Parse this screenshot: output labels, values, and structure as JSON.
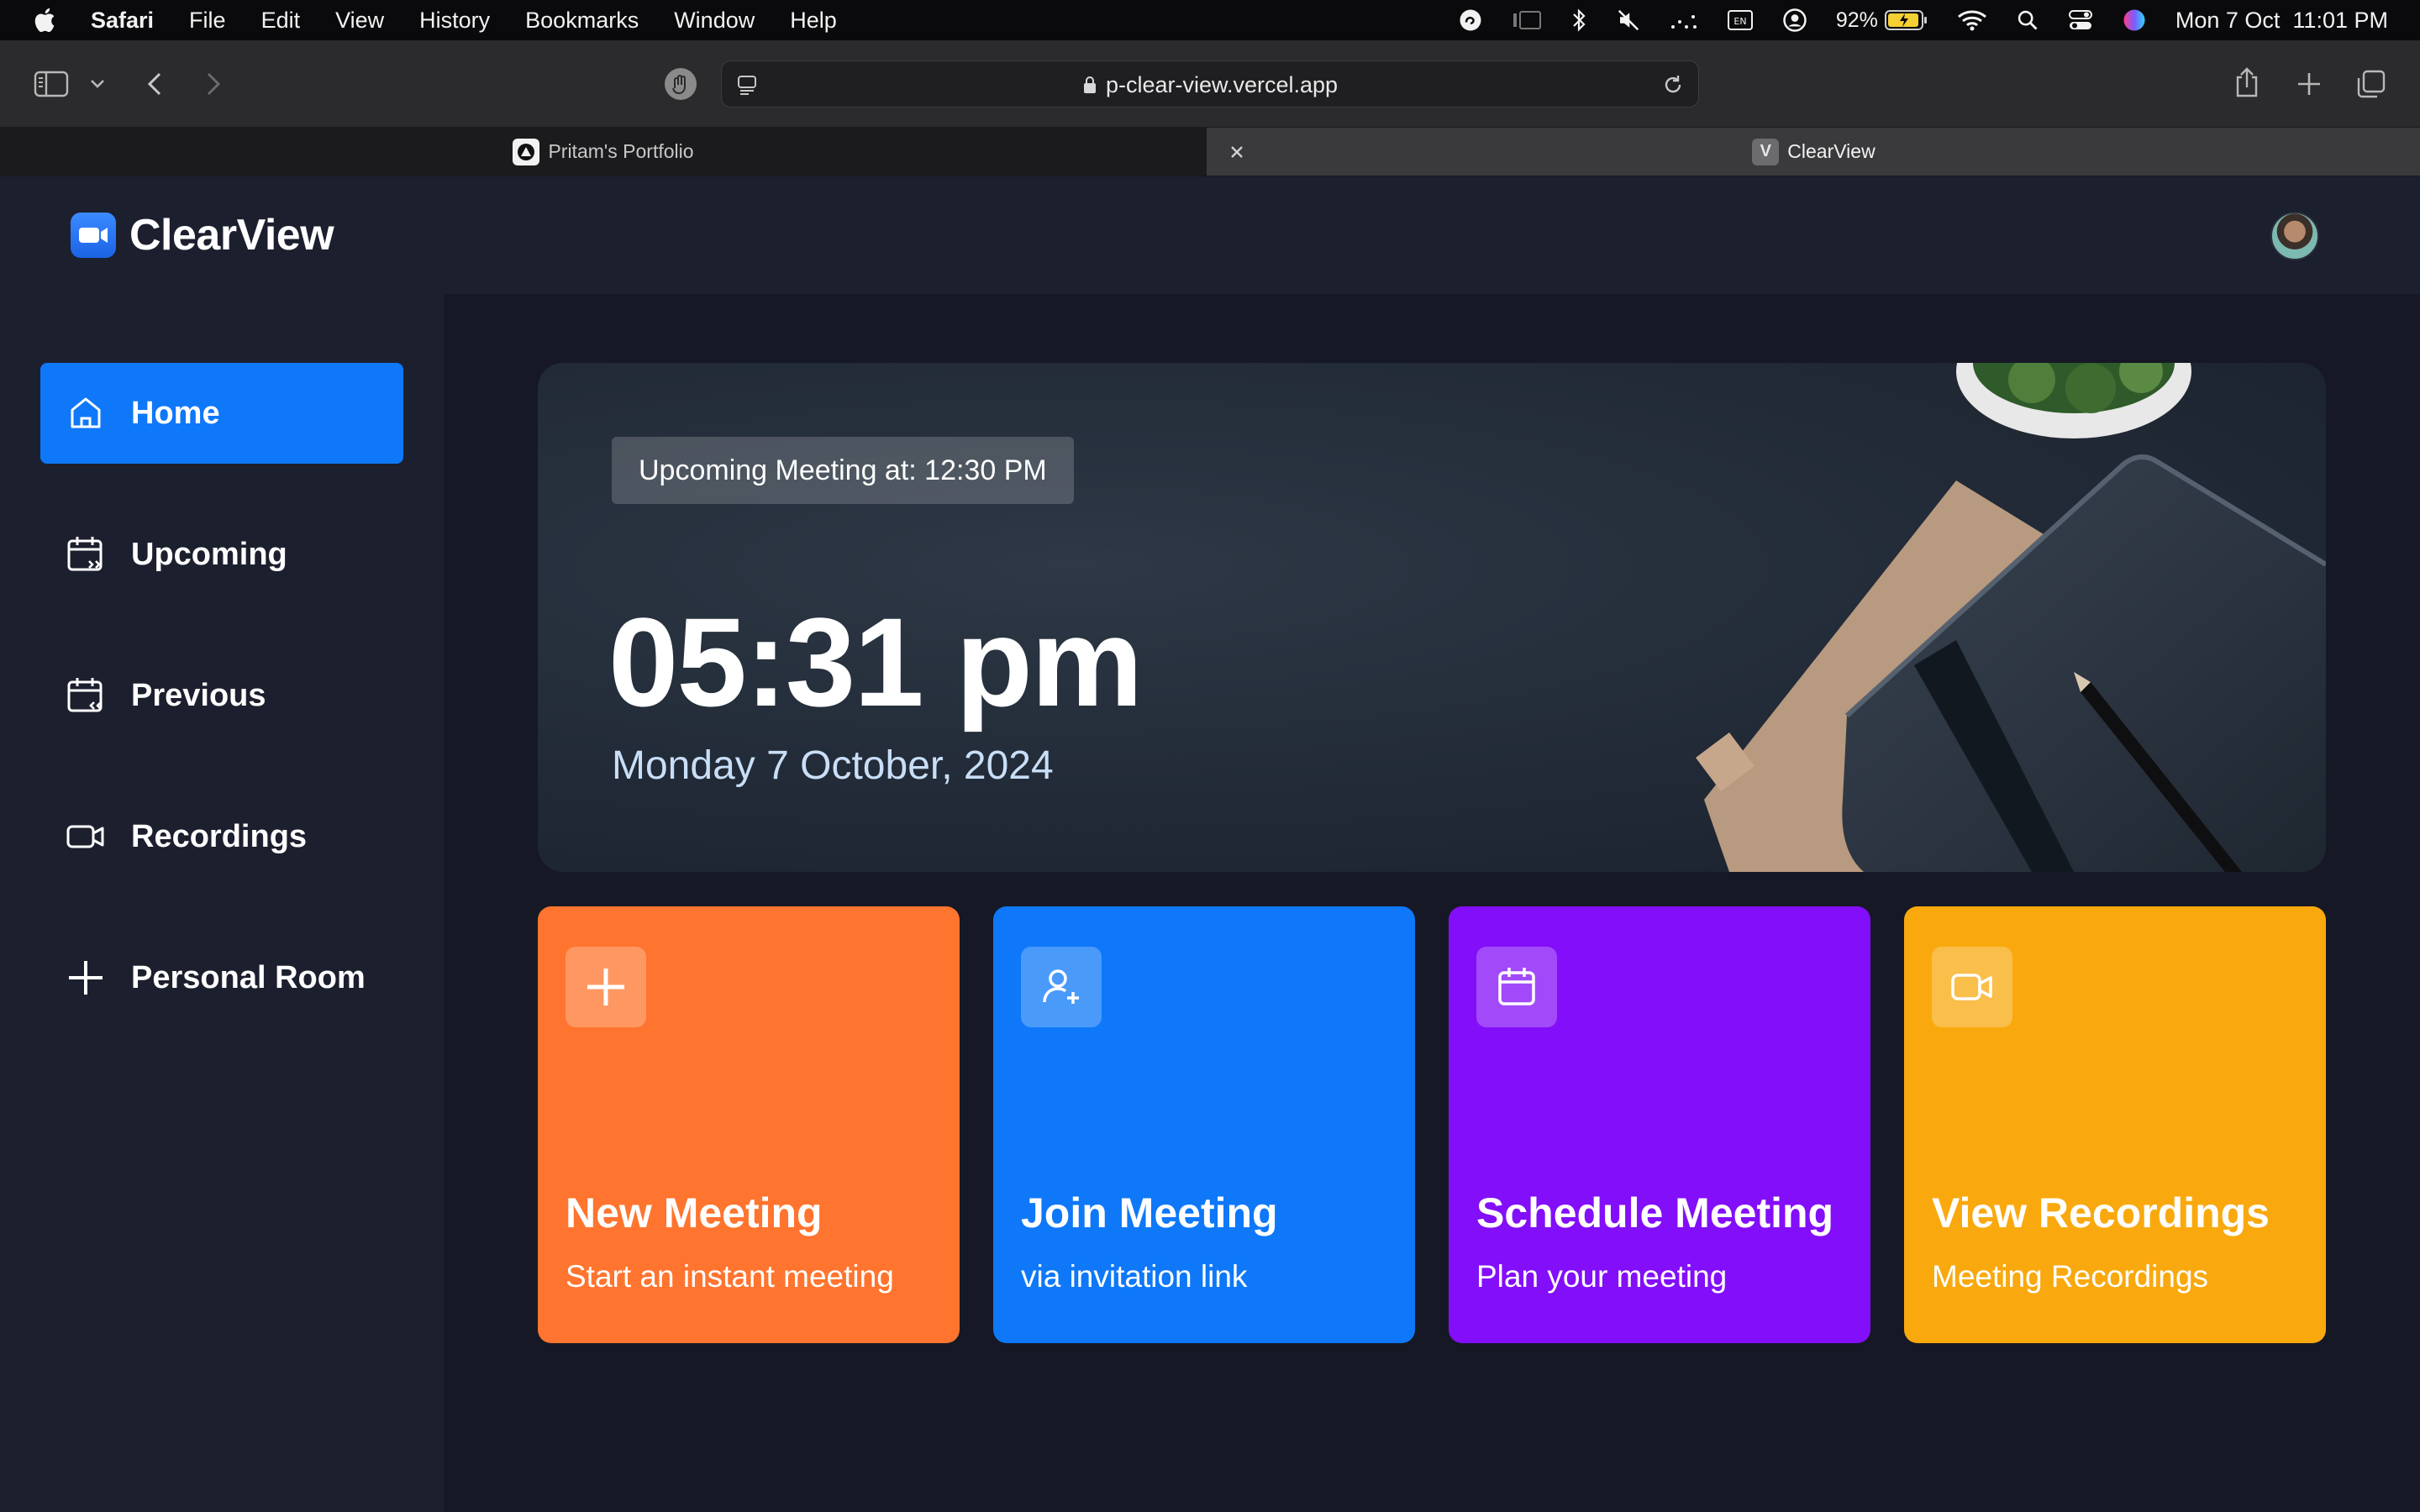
{
  "menubar": {
    "app": "Safari",
    "items": [
      "File",
      "Edit",
      "View",
      "History",
      "Bookmarks",
      "Window",
      "Help"
    ],
    "battery": "92%",
    "datetime": "Mon 7 Oct  11:01 PM"
  },
  "browser": {
    "url": "p-clear-view.vercel.app",
    "tabs": [
      {
        "title": "Pritam's Portfolio",
        "favicon": "triangle-icon"
      },
      {
        "title": "ClearView",
        "favicon": "V"
      }
    ]
  },
  "app": {
    "name": "ClearView"
  },
  "sidebar": {
    "items": [
      {
        "label": "Home",
        "icon": "home-icon",
        "active": true
      },
      {
        "label": "Upcoming",
        "icon": "calendar-forward-icon"
      },
      {
        "label": "Previous",
        "icon": "calendar-back-icon"
      },
      {
        "label": "Recordings",
        "icon": "video-icon"
      },
      {
        "label": "Personal Room",
        "icon": "plus-icon"
      }
    ]
  },
  "hero": {
    "upcoming": "Upcoming Meeting at: 12:30 PM",
    "time": "05:31 pm",
    "date": "Monday 7 October, 2024"
  },
  "cards": [
    {
      "title": "New Meeting",
      "subtitle": "Start an instant meeting",
      "icon": "plus-icon",
      "color": "#ff742e"
    },
    {
      "title": "Join Meeting",
      "subtitle": "via invitation link",
      "icon": "user-add-icon",
      "color": "#0e78f9"
    },
    {
      "title": "Schedule Meeting",
      "subtitle": "Plan your meeting",
      "icon": "calendar-icon",
      "color": "#830ef9"
    },
    {
      "title": "View Recordings",
      "subtitle": "Meeting Recordings",
      "icon": "video-icon",
      "color": "#f9a90e"
    }
  ]
}
